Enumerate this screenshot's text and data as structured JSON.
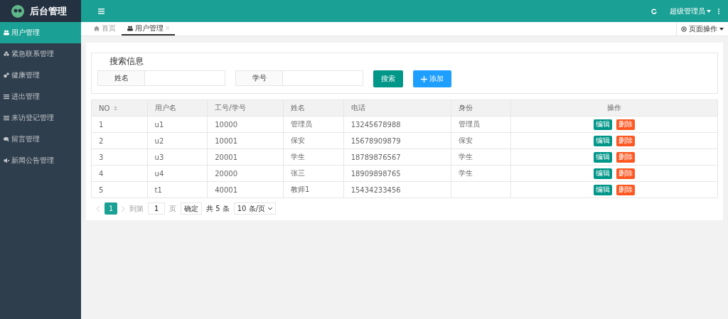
{
  "brand": {
    "title": "后台管理"
  },
  "header": {
    "user": "超级管理员"
  },
  "sidebar": {
    "items": [
      {
        "label": "用户管理",
        "selected": true
      },
      {
        "label": "紧急联系管理",
        "selected": false
      },
      {
        "label": "健康管理",
        "selected": false
      },
      {
        "label": "进出管理",
        "selected": false
      },
      {
        "label": "来访登记管理",
        "selected": false
      },
      {
        "label": "留言管理",
        "selected": false
      },
      {
        "label": "新闻公告管理",
        "selected": false
      }
    ]
  },
  "tabs": [
    {
      "label": "首页",
      "closable": false,
      "selected": false
    },
    {
      "label": "用户管理",
      "closable": true,
      "selected": true
    }
  ],
  "page_actions": "页面操作",
  "search": {
    "legend": "搜索信息",
    "fields": [
      {
        "label": "姓名"
      },
      {
        "label": "学号"
      }
    ],
    "search_button": "搜索",
    "add_button": "添加"
  },
  "table": {
    "columns": [
      "NO",
      "用户名",
      "工号/学号",
      "姓名",
      "电话",
      "身份",
      "操作"
    ],
    "rows": [
      {
        "cells": [
          "1",
          "u1",
          "10000",
          "管理员",
          "13245678988",
          "管理员"
        ],
        "edit": "编辑",
        "delete": "删除"
      },
      {
        "cells": [
          "2",
          "u2",
          "10001",
          "保安",
          "15678909879",
          "保安"
        ],
        "edit": "编辑",
        "delete": "删除"
      },
      {
        "cells": [
          "3",
          "u3",
          "20001",
          "学生",
          "18789876567",
          "学生"
        ],
        "edit": "编辑",
        "delete": "删除"
      },
      {
        "cells": [
          "4",
          "u4",
          "20000",
          "张三",
          "18909898765",
          "学生"
        ],
        "edit": "编辑",
        "delete": "删除"
      },
      {
        "cells": [
          "5",
          "t1",
          "40001",
          "教师1",
          "15434233456",
          ""
        ],
        "edit": "编辑",
        "delete": "删除"
      }
    ]
  },
  "pagination": {
    "current": "1",
    "goto_label": "到第",
    "goto_value": "1",
    "page_unit": "页",
    "confirm": "确定",
    "total": "共 5 条",
    "page_size": "10 条/页"
  }
}
